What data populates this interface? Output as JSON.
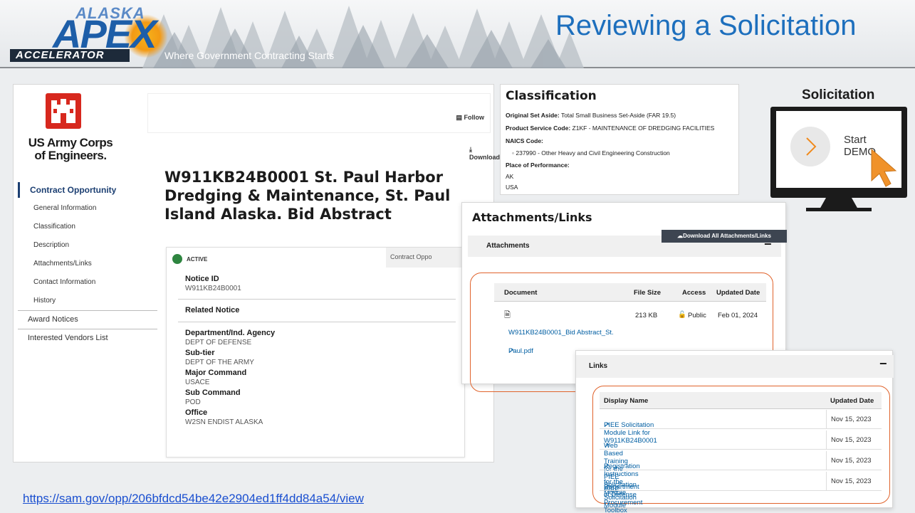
{
  "banner": {
    "logo_top": "ALASKA",
    "logo_main": "APEX",
    "logo_bottom": "ACCELERATOR",
    "tagline": "Where Government Contracting Starts",
    "slide_title": "Reviewing a Solicitation"
  },
  "agency": {
    "name_line1": "US Army Corps",
    "name_line2": "of Engineers."
  },
  "nav": {
    "header": "Contract Opportunity",
    "sub_items": [
      "General Information",
      "Classification",
      "Description",
      "Attachments/Links",
      "Contact Information",
      "History"
    ],
    "items": [
      "Award Notices",
      "Interested Vendors List"
    ]
  },
  "actions": {
    "follow": "Follow",
    "download": "Download"
  },
  "notice": {
    "title": "W911KB24B0001 St. Paul Harbor Dredging & Maintenance, St. Paul Island Alaska. Bid Abstract",
    "status": "ACTIVE",
    "tab": "Contract Oppo",
    "fields": [
      {
        "label": "Notice ID",
        "value": "W911KB24B0001"
      },
      {
        "label": "Related Notice",
        "value": ""
      },
      {
        "label": "Department/Ind. Agency",
        "value": "DEPT OF DEFENSE"
      },
      {
        "label": "Sub-tier",
        "value": "DEPT OF THE ARMY"
      },
      {
        "label": "Major Command",
        "value": "USACE"
      },
      {
        "label": "Sub Command",
        "value": "POD"
      },
      {
        "label": "Office",
        "value": "W2SN ENDIST ALASKA"
      }
    ]
  },
  "classification": {
    "heading": "Classification",
    "set_aside_label": "Original Set Aside:",
    "set_aside_value": "Total Small Business Set-Aside (FAR 19.5)",
    "psc_label": "Product Service Code:",
    "psc_value": "Z1KF - MAINTENANCE OF DREDGING FACILITIES",
    "naics_label": "NAICS Code:",
    "naics_value": "◦ 237990 - Other Heavy and Civil Engineering Construction",
    "pop_label": "Place of Performance:",
    "pop_state": "AK",
    "pop_country": "USA"
  },
  "demo": {
    "label": "Solicitation",
    "start": "Start",
    "demo": "DEMO"
  },
  "attachments": {
    "heading": "Attachments/Links",
    "download_all": "Download All Attachments/Links",
    "section": "Attachments",
    "columns": [
      "Document",
      "File Size",
      "Access",
      "Updated Date"
    ],
    "file_name_1": "W911KB24B0001_Bid Abstract_St.",
    "file_name_2": "Paul.pdf",
    "file_size": "213 KB",
    "access": "Public",
    "updated": "Feb 01, 2024"
  },
  "links": {
    "section": "Links",
    "columns": [
      "Display Name",
      "Updated Date"
    ],
    "rows": [
      {
        "name": "PIEE Solicitation Module Link for W911KB24B0001",
        "date": "Nov 15, 2023"
      },
      {
        "name": "Web Based Training for the PIEE Solicitation Module",
        "date": "Nov 15, 2023"
      },
      {
        "name": "Registration Instructions for the PIEE Solicitation Module",
        "date": "Nov 15, 2023"
      },
      {
        "name": "Department of Defense Procurement Toolbox",
        "date": "Nov 15, 2023"
      }
    ]
  },
  "footer": {
    "url": "https://sam.gov/opp/206bfdcd54be42e2904ed1ff4dd84a54/view"
  },
  "colors": {
    "title_blue": "#1d6fbd",
    "highlight_orange": "#e0632c",
    "active_green": "#2e8540",
    "link_blue": "#005ea2"
  }
}
